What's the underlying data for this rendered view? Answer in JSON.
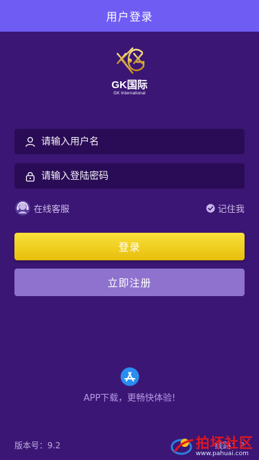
{
  "header": {
    "title": "用户登录"
  },
  "logo": {
    "name": "GK国际",
    "sub": "GK International"
  },
  "form": {
    "username_placeholder": "请输入用户名",
    "password_placeholder": "请输入登陆密码"
  },
  "options": {
    "support_label": "在线客服",
    "remember_label": "记住我"
  },
  "buttons": {
    "login_label": "登录",
    "register_label": "立即注册"
  },
  "app": {
    "download_label": "APP下载，更畅快体验!"
  },
  "footer": {
    "version": "版本号：9.2",
    "line": "线路：2"
  },
  "watermark": {
    "cn": "拍坏社区",
    "url": "www.pahuai.com"
  },
  "colors": {
    "background": "#3b1674",
    "header": "#6f5cf3",
    "accent": "#f2d21c",
    "register": "#8f72cd"
  }
}
